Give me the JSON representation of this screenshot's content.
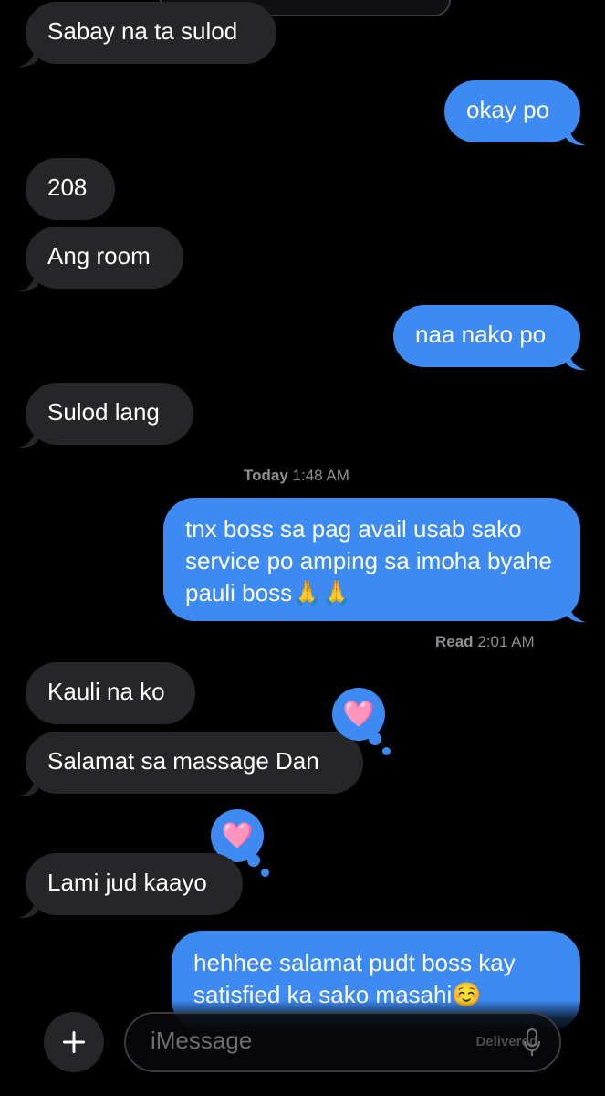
{
  "messages": [
    {
      "text": "Sabay na ta sulod"
    },
    {
      "text": "okay po"
    },
    {
      "text": "208"
    },
    {
      "text": "Ang room"
    },
    {
      "text": "naa nako po"
    },
    {
      "text": "Sulod lang"
    },
    {
      "text": "tnx boss sa pag avail usab sako service po amping sa imoha byahe pauli boss🙏🙏"
    },
    {
      "text": "Kauli na ko"
    },
    {
      "text": "Salamat sa massage Dan"
    },
    {
      "text": "Lami jud kaayo"
    },
    {
      "text": "hehhee salamat pudt boss kay satisfied ka sako masahi☺️"
    }
  ],
  "timestamp": {
    "day": "Today",
    "time": "1:48 AM"
  },
  "read_receipt": {
    "label": "Read",
    "time": "2:01 AM"
  },
  "tapbacks": [
    {
      "icon": "heart-icon",
      "emoji": "🩷"
    },
    {
      "icon": "heart-icon",
      "emoji": "🩷"
    }
  ],
  "composer": {
    "placeholder": "iMessage",
    "delivered_label": "Delivered"
  },
  "colors": {
    "outgoing": "#3d8bf2",
    "incoming": "#262629",
    "background": "#000000"
  }
}
